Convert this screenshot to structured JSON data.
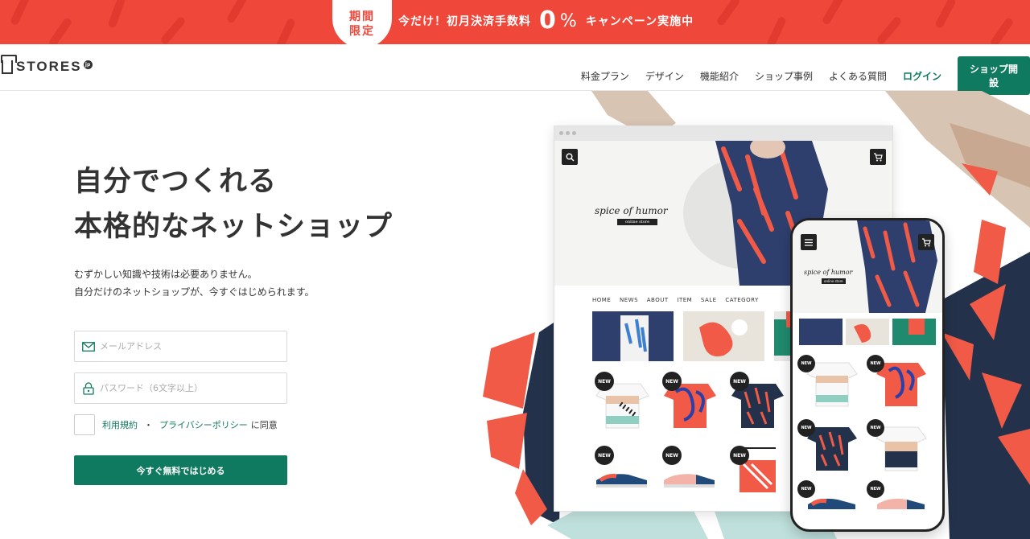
{
  "promo": {
    "badge": "期間限定",
    "text_before": "今だけ！初月決済手数料",
    "big": "0",
    "percent": "%",
    "text_after": "キャンペーン実施中"
  },
  "header": {
    "logo": "STORES",
    "logo_badge": "jp",
    "nav": [
      "料金プラン",
      "デザイン",
      "機能紹介",
      "ショップ事例",
      "よくある質問"
    ],
    "login": "ログイン",
    "open_shop": "ショップ開設"
  },
  "hero": {
    "title_line1": "自分でつくれる",
    "title_line2": "本格的なネットショップ",
    "sub_line1": "むずかしい知識や技術は必要ありません。",
    "sub_line2": "自分だけのネットショップが、今すぐはじめられます。"
  },
  "form": {
    "email_placeholder": "メールアドレス",
    "password_placeholder": "パスワード（6文字以上）",
    "terms_link": "利用規約",
    "separator": "・",
    "privacy_link": "プライバシーポリシー",
    "agree_tail": "に同意",
    "submit": "今すぐ無料ではじめる"
  },
  "mockup": {
    "brand": "spice of humor",
    "brand_sub": "online store",
    "menu": [
      "HOME",
      "NEWS",
      "ABOUT",
      "ITEM",
      "SALE",
      "CATEGORY"
    ],
    "badge": "NEW"
  },
  "colors": {
    "promo_red": "#f0473b",
    "brand_green": "#0f7a5f",
    "navy": "#23324a",
    "coral": "#f05a46"
  },
  "icons": {
    "email": "mail-icon",
    "password": "lock-icon",
    "search": "search-icon",
    "cart": "cart-icon",
    "menu": "hamburger-icon"
  }
}
